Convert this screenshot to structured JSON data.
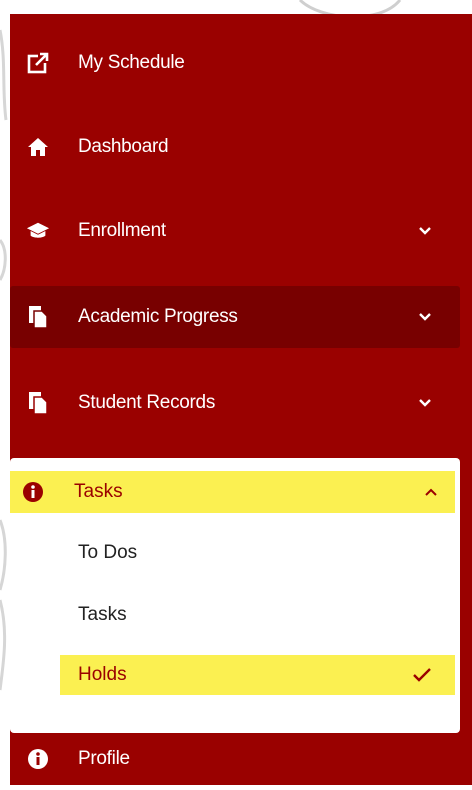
{
  "nav": {
    "items": [
      {
        "key": "my-schedule",
        "label": "My Schedule",
        "icon": "external-link-icon"
      },
      {
        "key": "dashboard",
        "label": "Dashboard",
        "icon": "home-icon"
      },
      {
        "key": "enrollment",
        "label": "Enrollment",
        "icon": "graduation-cap-icon",
        "expandable": true
      },
      {
        "key": "academic-progress",
        "label": "Academic Progress",
        "icon": "documents-icon",
        "expandable": true,
        "active": true
      },
      {
        "key": "student-records",
        "label": "Student Records",
        "icon": "documents-icon",
        "expandable": true
      },
      {
        "key": "profile",
        "label": "Profile",
        "icon": "info-circle-icon"
      }
    ]
  },
  "tasks": {
    "label": "Tasks",
    "icon": "info-circle-icon",
    "expanded": true,
    "subitems": [
      {
        "label": "To Dos"
      },
      {
        "label": "Tasks"
      },
      {
        "label": "Holds",
        "selected": true
      }
    ]
  },
  "colors": {
    "sidebar_bg": "#9a0100",
    "active_bg": "#780000",
    "highlight": "#fbf051",
    "text_light": "#ffffff",
    "accent_red": "#9a0100"
  }
}
